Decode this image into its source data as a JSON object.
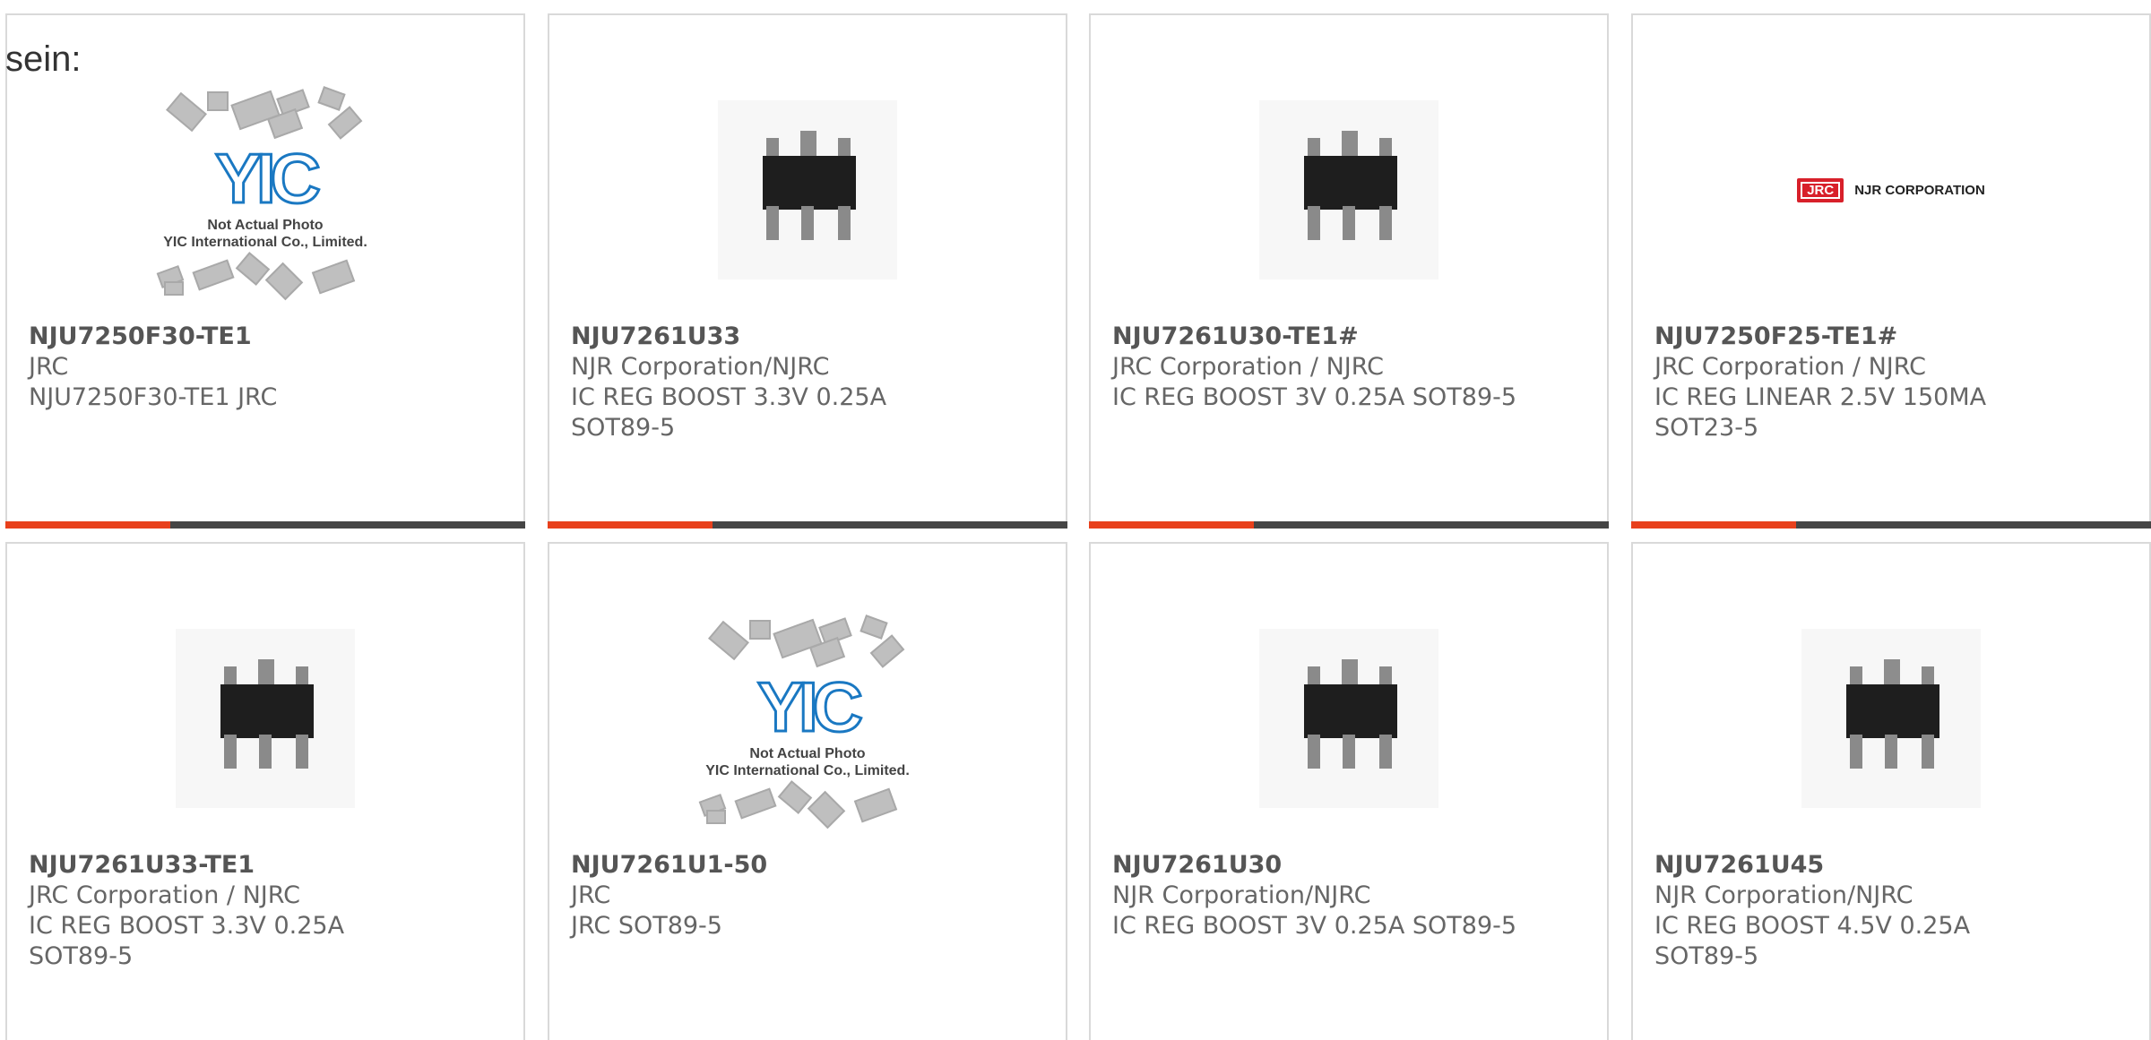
{
  "lead_text": "sein:",
  "colors": {
    "accent": "#e8401c",
    "bar": "#454545",
    "border": "#d9d9d9",
    "text": "#666666"
  },
  "placeholder": {
    "logo": "YIC",
    "caption_line1": "Not Actual Photo",
    "caption_line2": "YIC International Co., Limited."
  },
  "njr_logo": {
    "badge": "JRC",
    "name": "NJR CORPORATION"
  },
  "products": [
    {
      "part": "NJU7250F30-TE1",
      "maker": "JRC",
      "desc1": "NJU7250F30-TE1 JRC",
      "desc2": "",
      "image": "placeholder-photo"
    },
    {
      "part": "NJU7261U33",
      "maker": "NJR Corporation/NJRC",
      "desc1": "IC REG BOOST 3.3V 0.25A",
      "desc2": "SOT89-5",
      "image": "sot89-chip-photo"
    },
    {
      "part": "NJU7261U30-TE1#",
      "maker": "JRC Corporation / NJRC",
      "desc1": "IC REG BOOST 3V 0.25A SOT89-5",
      "desc2": "",
      "image": "sot89-chip-photo"
    },
    {
      "part": "NJU7250F25-TE1#",
      "maker": "JRC Corporation / NJRC",
      "desc1": "IC REG LINEAR 2.5V 150MA",
      "desc2": "SOT23-5",
      "image": "njr-logo"
    },
    {
      "part": "NJU7261U33-TE1",
      "maker": "JRC Corporation / NJRC",
      "desc1": "IC REG BOOST 3.3V 0.25A",
      "desc2": "SOT89-5",
      "image": "sot89-chip-photo"
    },
    {
      "part": "NJU7261U1-50",
      "maker": "JRC",
      "desc1": "JRC SOT89-5",
      "desc2": "",
      "image": "placeholder-photo"
    },
    {
      "part": "NJU7261U30",
      "maker": "NJR Corporation/NJRC",
      "desc1": "IC REG BOOST 3V 0.25A SOT89-5",
      "desc2": "",
      "image": "sot89-chip-photo"
    },
    {
      "part": "NJU7261U45",
      "maker": "NJR Corporation/NJRC",
      "desc1": "IC REG BOOST 4.5V 0.25A",
      "desc2": "SOT89-5",
      "image": "sot89-chip-photo"
    }
  ]
}
